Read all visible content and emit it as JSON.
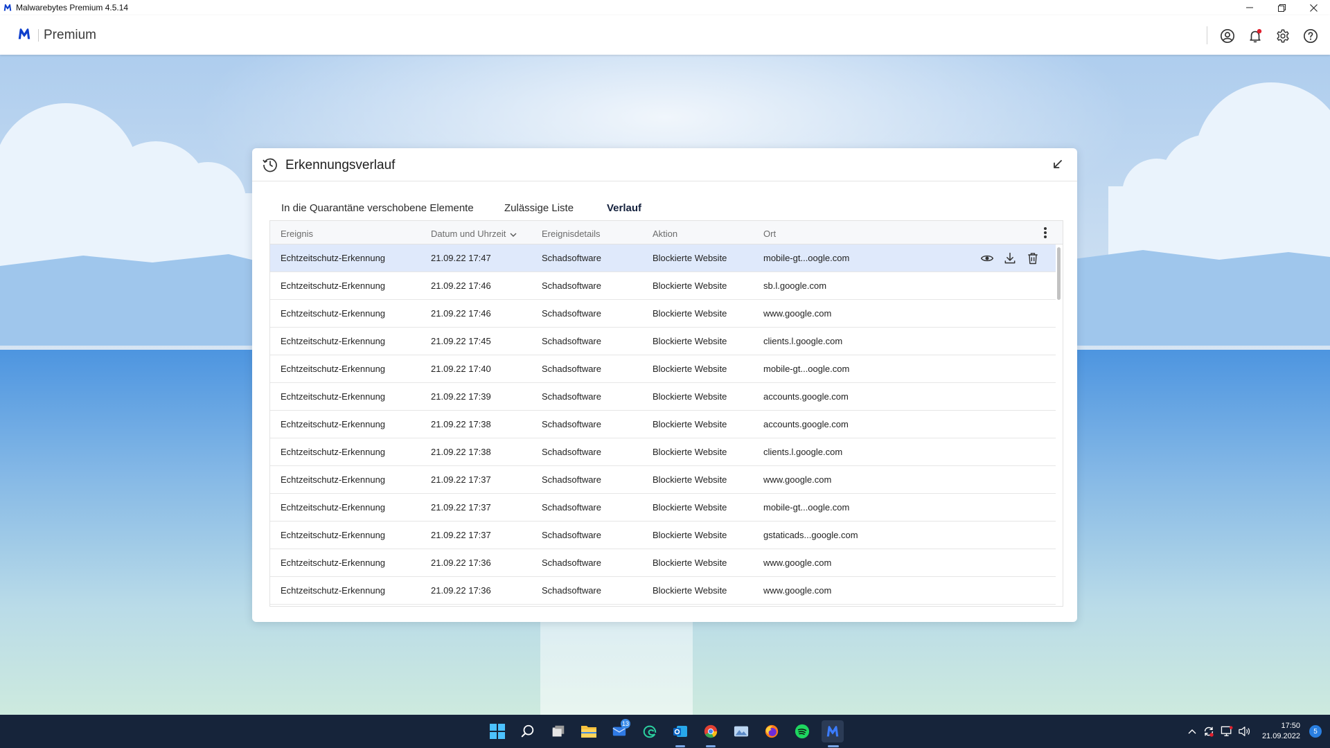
{
  "window": {
    "title": "Malwarebytes Premium  4.5.14"
  },
  "header": {
    "app_name": "Premium"
  },
  "panel": {
    "title": "Erkennungsverlauf",
    "tabs": [
      {
        "label": "In die Quarantäne verschobene Elemente",
        "active": false
      },
      {
        "label": "Zulässige Liste",
        "active": false
      },
      {
        "label": "Verlauf",
        "active": true
      }
    ],
    "table": {
      "columns": [
        "Ereignis",
        "Datum und Uhrzeit",
        "Ereignisdetails",
        "Aktion",
        "Ort"
      ],
      "sort_column": "Datum und Uhrzeit",
      "sort_direction": "descending",
      "rows": [
        {
          "event": "Echtzeitschutz-Erkennung",
          "datetime": "21.09.22 17:47",
          "details": "Schadsoftware",
          "action": "Blockierte Website",
          "location": "mobile-gt...oogle.com",
          "selected": true
        },
        {
          "event": "Echtzeitschutz-Erkennung",
          "datetime": "21.09.22 17:46",
          "details": "Schadsoftware",
          "action": "Blockierte Website",
          "location": "sb.l.google.com"
        },
        {
          "event": "Echtzeitschutz-Erkennung",
          "datetime": "21.09.22 17:46",
          "details": "Schadsoftware",
          "action": "Blockierte Website",
          "location": "www.google.com"
        },
        {
          "event": "Echtzeitschutz-Erkennung",
          "datetime": "21.09.22 17:45",
          "details": "Schadsoftware",
          "action": "Blockierte Website",
          "location": "clients.l.google.com"
        },
        {
          "event": "Echtzeitschutz-Erkennung",
          "datetime": "21.09.22 17:40",
          "details": "Schadsoftware",
          "action": "Blockierte Website",
          "location": "mobile-gt...oogle.com"
        },
        {
          "event": "Echtzeitschutz-Erkennung",
          "datetime": "21.09.22 17:39",
          "details": "Schadsoftware",
          "action": "Blockierte Website",
          "location": "accounts.google.com"
        },
        {
          "event": "Echtzeitschutz-Erkennung",
          "datetime": "21.09.22 17:38",
          "details": "Schadsoftware",
          "action": "Blockierte Website",
          "location": "accounts.google.com"
        },
        {
          "event": "Echtzeitschutz-Erkennung",
          "datetime": "21.09.22 17:38",
          "details": "Schadsoftware",
          "action": "Blockierte Website",
          "location": "clients.l.google.com"
        },
        {
          "event": "Echtzeitschutz-Erkennung",
          "datetime": "21.09.22 17:37",
          "details": "Schadsoftware",
          "action": "Blockierte Website",
          "location": "www.google.com"
        },
        {
          "event": "Echtzeitschutz-Erkennung",
          "datetime": "21.09.22 17:37",
          "details": "Schadsoftware",
          "action": "Blockierte Website",
          "location": "mobile-gt...oogle.com"
        },
        {
          "event": "Echtzeitschutz-Erkennung",
          "datetime": "21.09.22 17:37",
          "details": "Schadsoftware",
          "action": "Blockierte Website",
          "location": "gstaticads...google.com"
        },
        {
          "event": "Echtzeitschutz-Erkennung",
          "datetime": "21.09.22 17:36",
          "details": "Schadsoftware",
          "action": "Blockierte Website",
          "location": "www.google.com"
        },
        {
          "event": "Echtzeitschutz-Erkennung",
          "datetime": "21.09.22 17:36",
          "details": "Schadsoftware",
          "action": "Blockierte Website",
          "location": "www.google.com"
        }
      ],
      "row_action_icons": [
        "eye-icon",
        "download-icon",
        "trash-icon"
      ]
    }
  },
  "taskbar": {
    "apps": [
      "start-icon",
      "search-icon",
      "task-view-icon",
      "file-explorer-icon",
      "mail-icon",
      "edge-icon",
      "outlook-icon",
      "chrome-icon",
      "photos-icon",
      "firefox-icon",
      "spotify-icon",
      "malwarebytes-icon"
    ],
    "mail_badge": "13",
    "clock_time": "17:50",
    "clock_date": "21.09.2022",
    "notification_count": "5"
  },
  "colors": {
    "accent": "#1a44b8",
    "brand": "#0d3ecc",
    "selected_row": "#dfe9fb",
    "taskbar": "#16243a"
  }
}
